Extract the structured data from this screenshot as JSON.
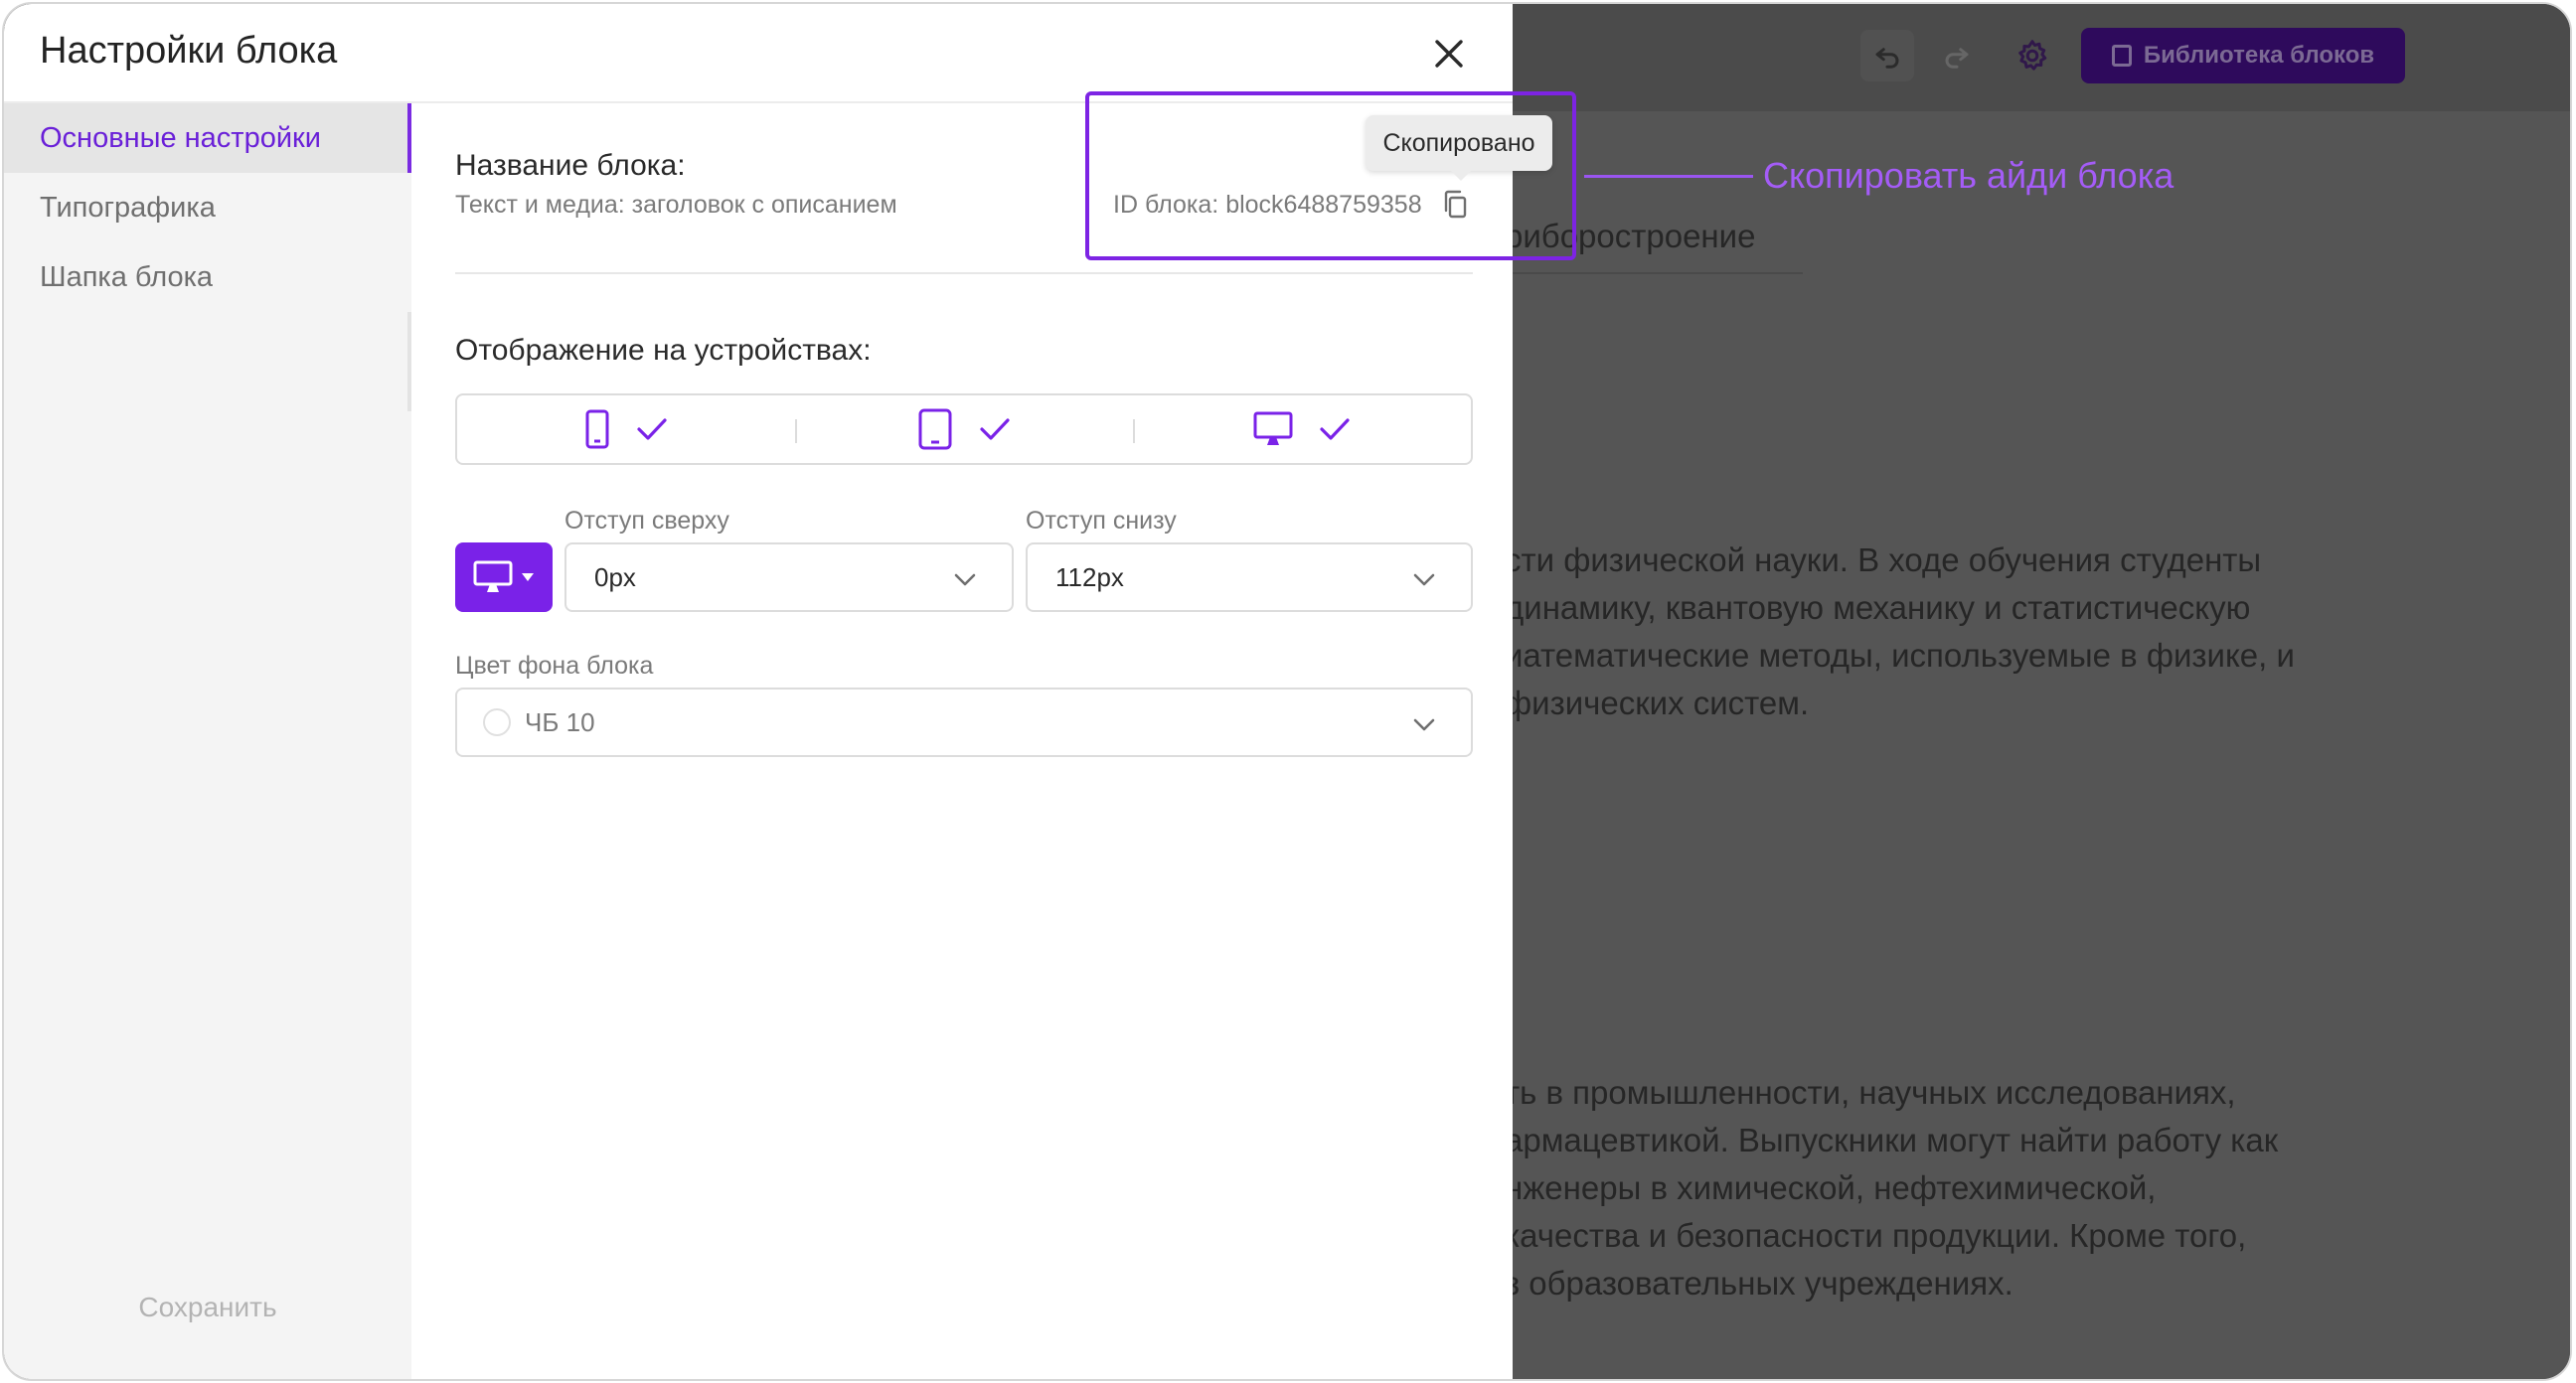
{
  "modal": {
    "title": "Настройки блока",
    "nav": [
      "Основные настройки",
      "Типографика",
      "Шапка блока"
    ],
    "save_label": "Сохранить",
    "block_name_label": "Название блока:",
    "block_name_value": "Текст и медиа: заголовок с описанием",
    "block_id_text": "ID блока: block6488759358",
    "tooltip": "Скопировано",
    "devices_label": "Отображение на устройствах:",
    "devices": [
      {
        "icon": "phone-icon",
        "enabled": true
      },
      {
        "icon": "tablet-icon",
        "enabled": true
      },
      {
        "icon": "desktop-icon",
        "enabled": true
      }
    ],
    "padding_top_label": "Отступ сверху",
    "padding_top_value": "0px",
    "padding_bottom_label": "Отступ снизу",
    "padding_bottom_value": "112px",
    "bg_color_label": "Цвет фона блока",
    "bg_color_value": "ЧБ 10"
  },
  "annotation": {
    "callout": "Скопировать айди блока"
  },
  "background": {
    "library_button": "Библиотека блоков",
    "breadcrumb_fragment": "риборостроение",
    "paragraph1": [
      "сти физической науки. В ходе обучения студенты",
      "динамику, квантовую механику и статистическую",
      "иатематические методы, используемые в физике, и",
      "физических систем."
    ],
    "paragraph2": [
      "ть в промышленности, научных исследованиях,",
      "армацевтикой. Выпускники могут найти работу как",
      "нженеры в химической, нефтехимической,",
      "качества и безопасности продукции. Кроме того,",
      "з образовательных учреждениях."
    ]
  },
  "colors": {
    "accent": "#7a22e8",
    "callout": "#a45cf7",
    "overlay": "#555555"
  }
}
